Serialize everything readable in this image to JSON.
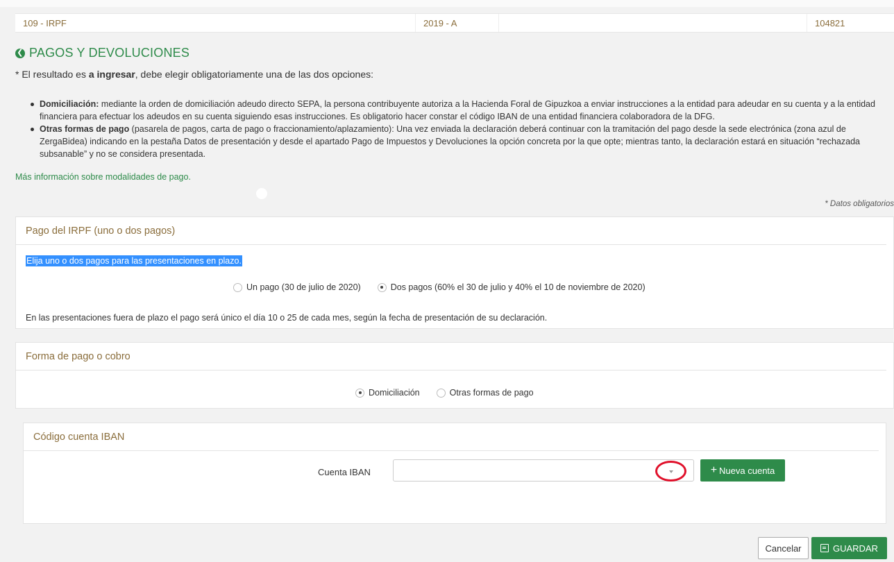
{
  "header": {
    "model": "109 - IRPF",
    "period": "2019 - A",
    "blank": "",
    "reference": "104821"
  },
  "section": {
    "title": "PAGOS Y DEVOLUCIONES",
    "intro_prefix": "* El resultado es ",
    "intro_bold": "a ingresar",
    "intro_suffix": ", debe elegir obligatoriamente una de las dos opciones:"
  },
  "bullets": [
    {
      "bold": "Domiciliación:",
      "text": " mediante la orden de domiciliación adeudo directo SEPA, la persona contribuyente autoriza a la Hacienda Foral de Gipuzkoa a enviar instrucciones a la entidad para adeudar en su cuenta y a la entidad financiera para efectuar los adeudos en su cuenta siguiendo esas instrucciones. Es obligatorio hacer constar el código IBAN de una entidad financiera colaboradora de la DFG."
    },
    {
      "bold": "Otras formas de pago",
      "text": " (pasarela de pagos, carta de pago o fraccionamiento/aplazamiento): Una vez enviada la declaración deberá continuar con la tramitación del pago desde la sede electrónica (zona azul de ZergaBidea) indicando en la pestaña Datos de presentación y desde el apartado Pago de Impuestos y Devoluciones la opción concreta por la que opte; mientras tanto, la declaración estará en situación “rechazada subsanable” y no se considera presentada."
    }
  ],
  "more_info": "Más información sobre modalidades de pago.",
  "required_note": "* Datos obligatorios",
  "payment_panel": {
    "title": "Pago del IRPF (uno o dos pagos)",
    "highlight": "Elija uno o dos pagos para las presentaciones en plazo.",
    "options": [
      {
        "label": "Un pago (30 de julio de 2020)",
        "checked": false
      },
      {
        "label": "Dos pagos (60% el 30 de julio y 40% el 10 de noviembre de 2020)",
        "checked": true
      }
    ],
    "late_note": "En las presentaciones fuera de plazo el pago será único el día 10 o 25 de cada mes, según la fecha de presentación de su declaración."
  },
  "method_panel": {
    "title": "Forma de pago o cobro",
    "options": [
      {
        "label": "Domiciliación",
        "checked": true
      },
      {
        "label": "Otras formas de pago",
        "checked": false
      }
    ]
  },
  "iban_panel": {
    "title": "Código cuenta IBAN",
    "label": "Cuenta IBAN",
    "value": "",
    "new_account": "Nueva cuenta"
  },
  "actions": {
    "cancel": "Cancelar",
    "save": "GUARDAR"
  },
  "colors": {
    "accent_green": "#2e8b4a",
    "panel_title": "#8a6d3b",
    "highlight_blue": "#3390ff",
    "annotation_red": "#e0102a"
  }
}
